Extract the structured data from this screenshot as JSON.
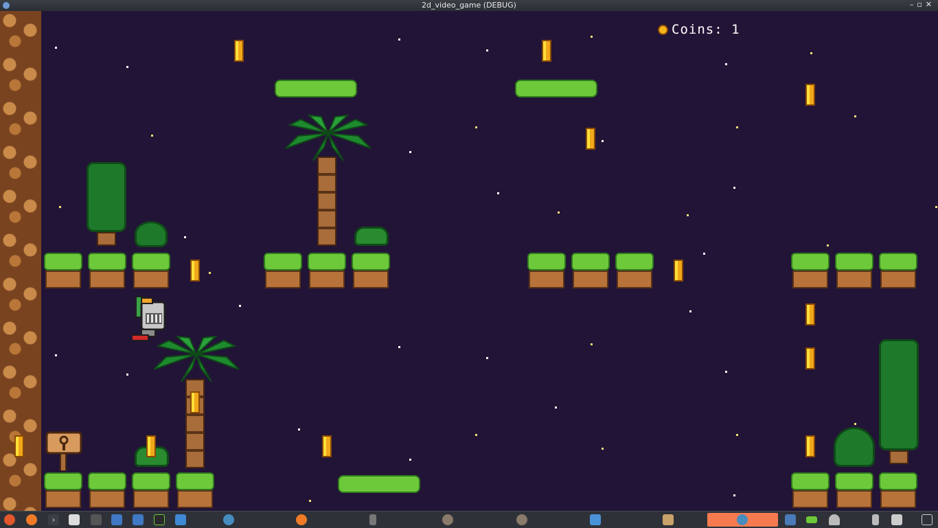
{
  "window": {
    "title": "2d_video_game (DEBUG)",
    "controls": [
      "minimize",
      "maximize",
      "close"
    ]
  },
  "hud": {
    "coins_label": "Coins: 1",
    "coin_icon": "coin-icon"
  },
  "colors": {
    "sky": "#221436",
    "grass": "#6ec93a",
    "dirt": "#b8733a",
    "coin": "#f5b51c",
    "taskbar_active": "#f57a50"
  },
  "taskbar": {
    "icons": [
      "ubuntu-menu-icon",
      "firefox-icon",
      "terminal-icon",
      "info-icon",
      "usb-icon",
      "screenshot-icon",
      "text-editor-icon",
      "code-icon",
      "file-manager-icon",
      "godot-icon",
      "firefox-icon",
      "usb-icon",
      "gimp-icon",
      "gimp-icon",
      "folder-icon",
      "archive-icon",
      "godot-active-icon",
      "network-icon",
      "battery-icon",
      "bell-icon",
      "usb-tray-icon",
      "volume-icon",
      "show-desktop-icon"
    ]
  }
}
